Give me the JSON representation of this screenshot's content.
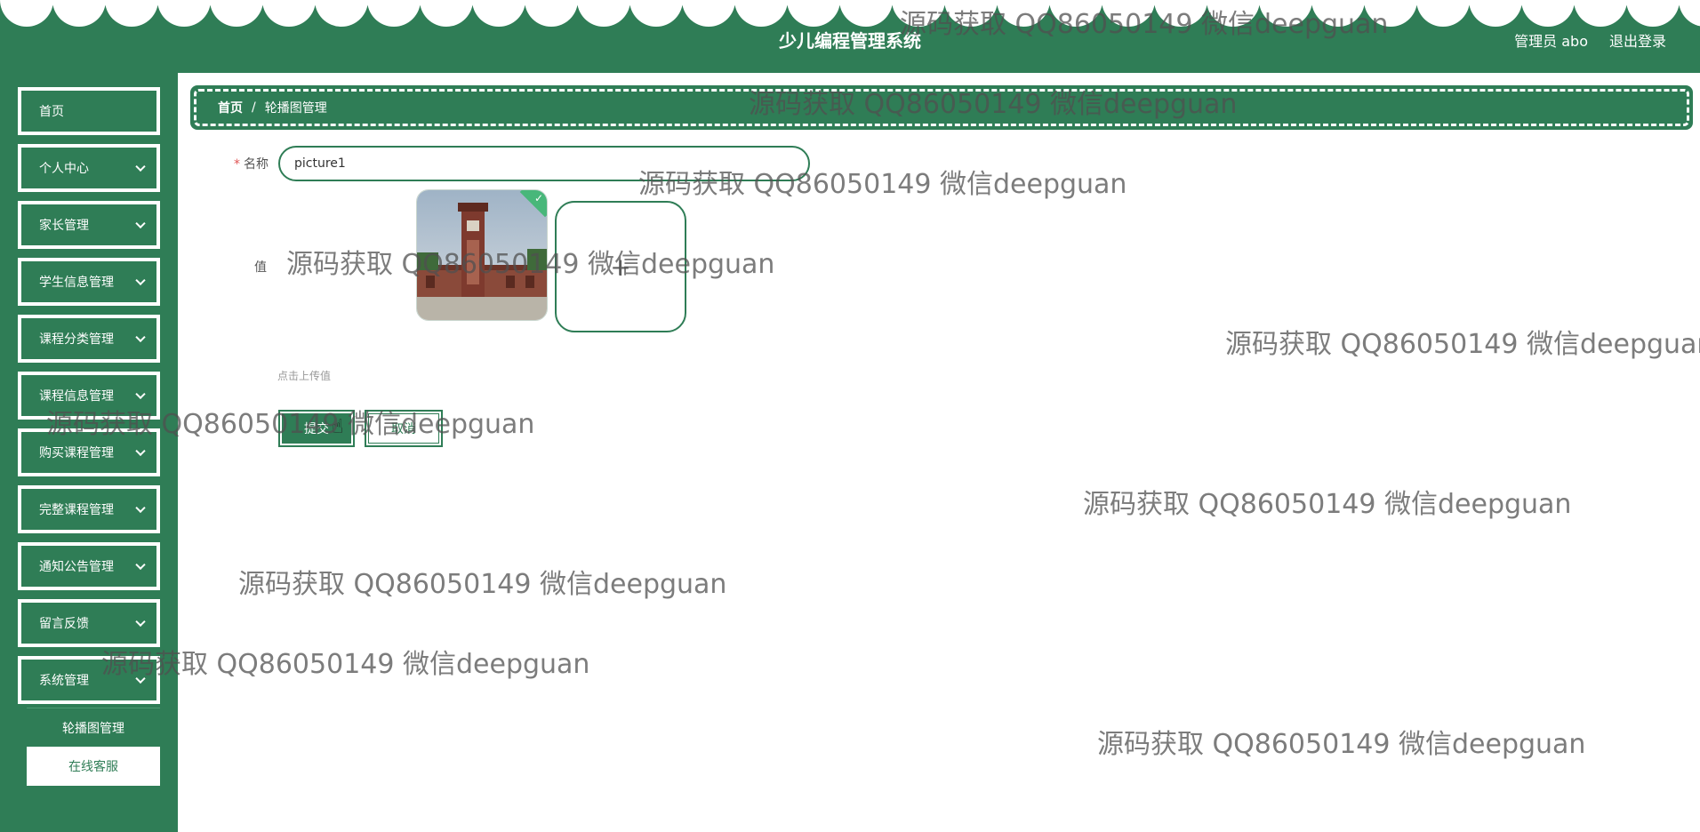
{
  "header": {
    "title": "少儿编程管理系统",
    "user": "管理员 abo",
    "logout": "退出登录"
  },
  "sidebar": {
    "items": [
      {
        "label": "首页"
      },
      {
        "label": "个人中心"
      },
      {
        "label": "家长管理"
      },
      {
        "label": "学生信息管理"
      },
      {
        "label": "课程分类管理"
      },
      {
        "label": "课程信息管理"
      },
      {
        "label": "购买课程管理"
      },
      {
        "label": "完整课程管理"
      },
      {
        "label": "通知公告管理"
      },
      {
        "label": "留言反馈"
      },
      {
        "label": "系统管理"
      }
    ],
    "submenu": [
      {
        "label": "轮播图管理"
      },
      {
        "label": "在线客服"
      }
    ]
  },
  "breadcrumb": {
    "home": "首页",
    "separator": "/",
    "current": "轮播图管理"
  },
  "form": {
    "name_label": "名称",
    "required_mark": "*",
    "name_value": "picture1",
    "value_label": "值",
    "upload_plus": "+",
    "upload_hint": "点击上传值",
    "submit": "提交",
    "cancel": "取消"
  },
  "watermark": "源码获取 QQ86050149 微信deepguan",
  "colors": {
    "primary": "#2f7d56",
    "background": "#ffffff",
    "accent_check": "#48b77a"
  }
}
